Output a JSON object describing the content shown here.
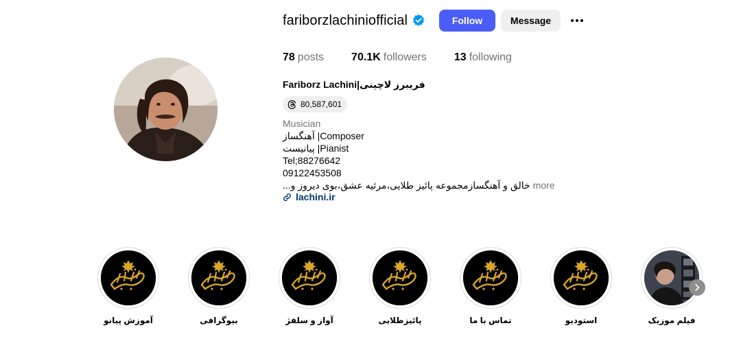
{
  "profile": {
    "username": "fariborzlachiniofficial",
    "follow_label": "Follow",
    "message_label": "Message",
    "stats": {
      "posts_count": "78",
      "posts_label": "posts",
      "followers_count": "70.1K",
      "followers_label": "followers",
      "following_count": "13",
      "following_label": "following"
    },
    "full_name": "Fariborz Lachini|فریبرز لاچینی",
    "threads_count": "80,587,601",
    "bio": {
      "category": "Musician",
      "lines": [
        "آهنگساز |Composer",
        "پیانیست |Pianist",
        "Tel;88276642",
        "09122453508",
        "خالق و آهنگسازمجموعه پائیز طلایی،مرثیه عشق،بوی دیروز و..."
      ],
      "more_label": "more"
    },
    "link": "lachini.ir"
  },
  "highlights": [
    {
      "label": "آموزش پیانو"
    },
    {
      "label": "بیوگرافی"
    },
    {
      "label": "آواز و سلفژ"
    },
    {
      "label": "پائیزطلایی"
    },
    {
      "label": "تماس با ما"
    },
    {
      "label": "استودیو"
    },
    {
      "label": "فیلم موزیک"
    }
  ],
  "icons": {
    "verified": "verified-badge-icon",
    "threads": "threads-icon",
    "link": "link-icon",
    "more": "more-options-icon",
    "next": "chevron-right-icon"
  },
  "colors": {
    "follow_button": "#4a5df9",
    "verified_badge": "#0095f6",
    "link_text": "#00376b",
    "highlight_logo_gold": "#d9a62a"
  }
}
